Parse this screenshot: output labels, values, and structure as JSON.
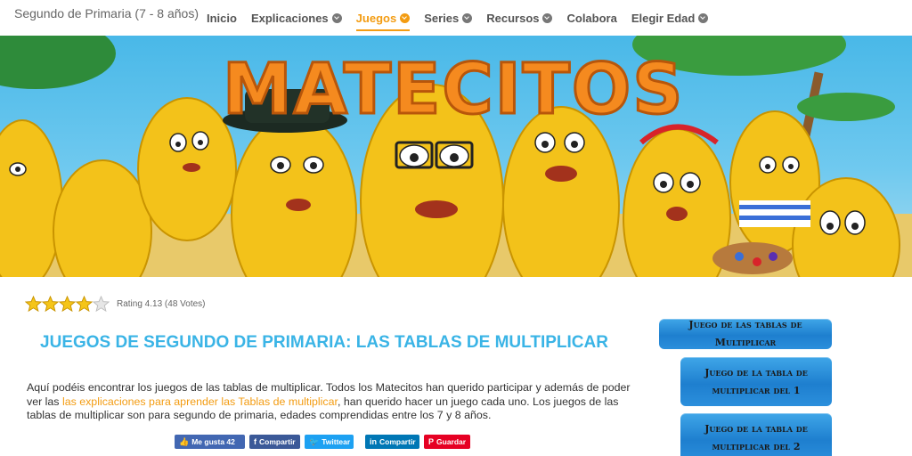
{
  "header": {
    "site_title": "Segundo de Primaria (7 - 8 años)",
    "nav": [
      {
        "label": "Inicio",
        "dropdown": false,
        "active": false
      },
      {
        "label": "Explicaciones",
        "dropdown": true,
        "active": false
      },
      {
        "label": "Juegos",
        "dropdown": true,
        "active": true
      },
      {
        "label": "Series",
        "dropdown": true,
        "active": false
      },
      {
        "label": "Recursos",
        "dropdown": true,
        "active": false
      },
      {
        "label": "Colabora",
        "dropdown": false,
        "active": false
      },
      {
        "label": "Elegir Edad",
        "dropdown": true,
        "active": false
      }
    ]
  },
  "banner": {
    "title": "MATECITOS"
  },
  "rating": {
    "stars_filled": 4,
    "stars_total": 5,
    "text": "Rating 4.13 (48 Votes)"
  },
  "main": {
    "heading": "JUEGOS DE SEGUNDO DE PRIMARIA: LAS TABLAS DE MULTIPLICAR",
    "para_part1": "Aquí podéis encontrar los juegos de las tablas de multiplicar. Todos los Matecitos han querido participar y además de poder ver las ",
    "para_link": "las explicaciones para aprender las Tablas de multiplicar",
    "para_part2": ", han querido hacer un juego cada uno. Los juegos de las tablas de multiplicar son para segundo de primaria, edades comprendidas entre los 7 y 8 años."
  },
  "share": {
    "like": "Me gusta 42",
    "facebook": "Compartir",
    "twitter": "Twittear",
    "linkedin": "Compartir",
    "pinterest": "Guardar"
  },
  "sidebar": {
    "buttons": [
      "Juego de las tablas de Multiplicar",
      "Juego de la tabla de multiplicar del 1",
      "Juego de la tabla de multiplicar del 2"
    ]
  },
  "colors": {
    "accent": "#f39c12",
    "heading": "#3ab4e6",
    "button_blue": "#1e7fcf"
  }
}
